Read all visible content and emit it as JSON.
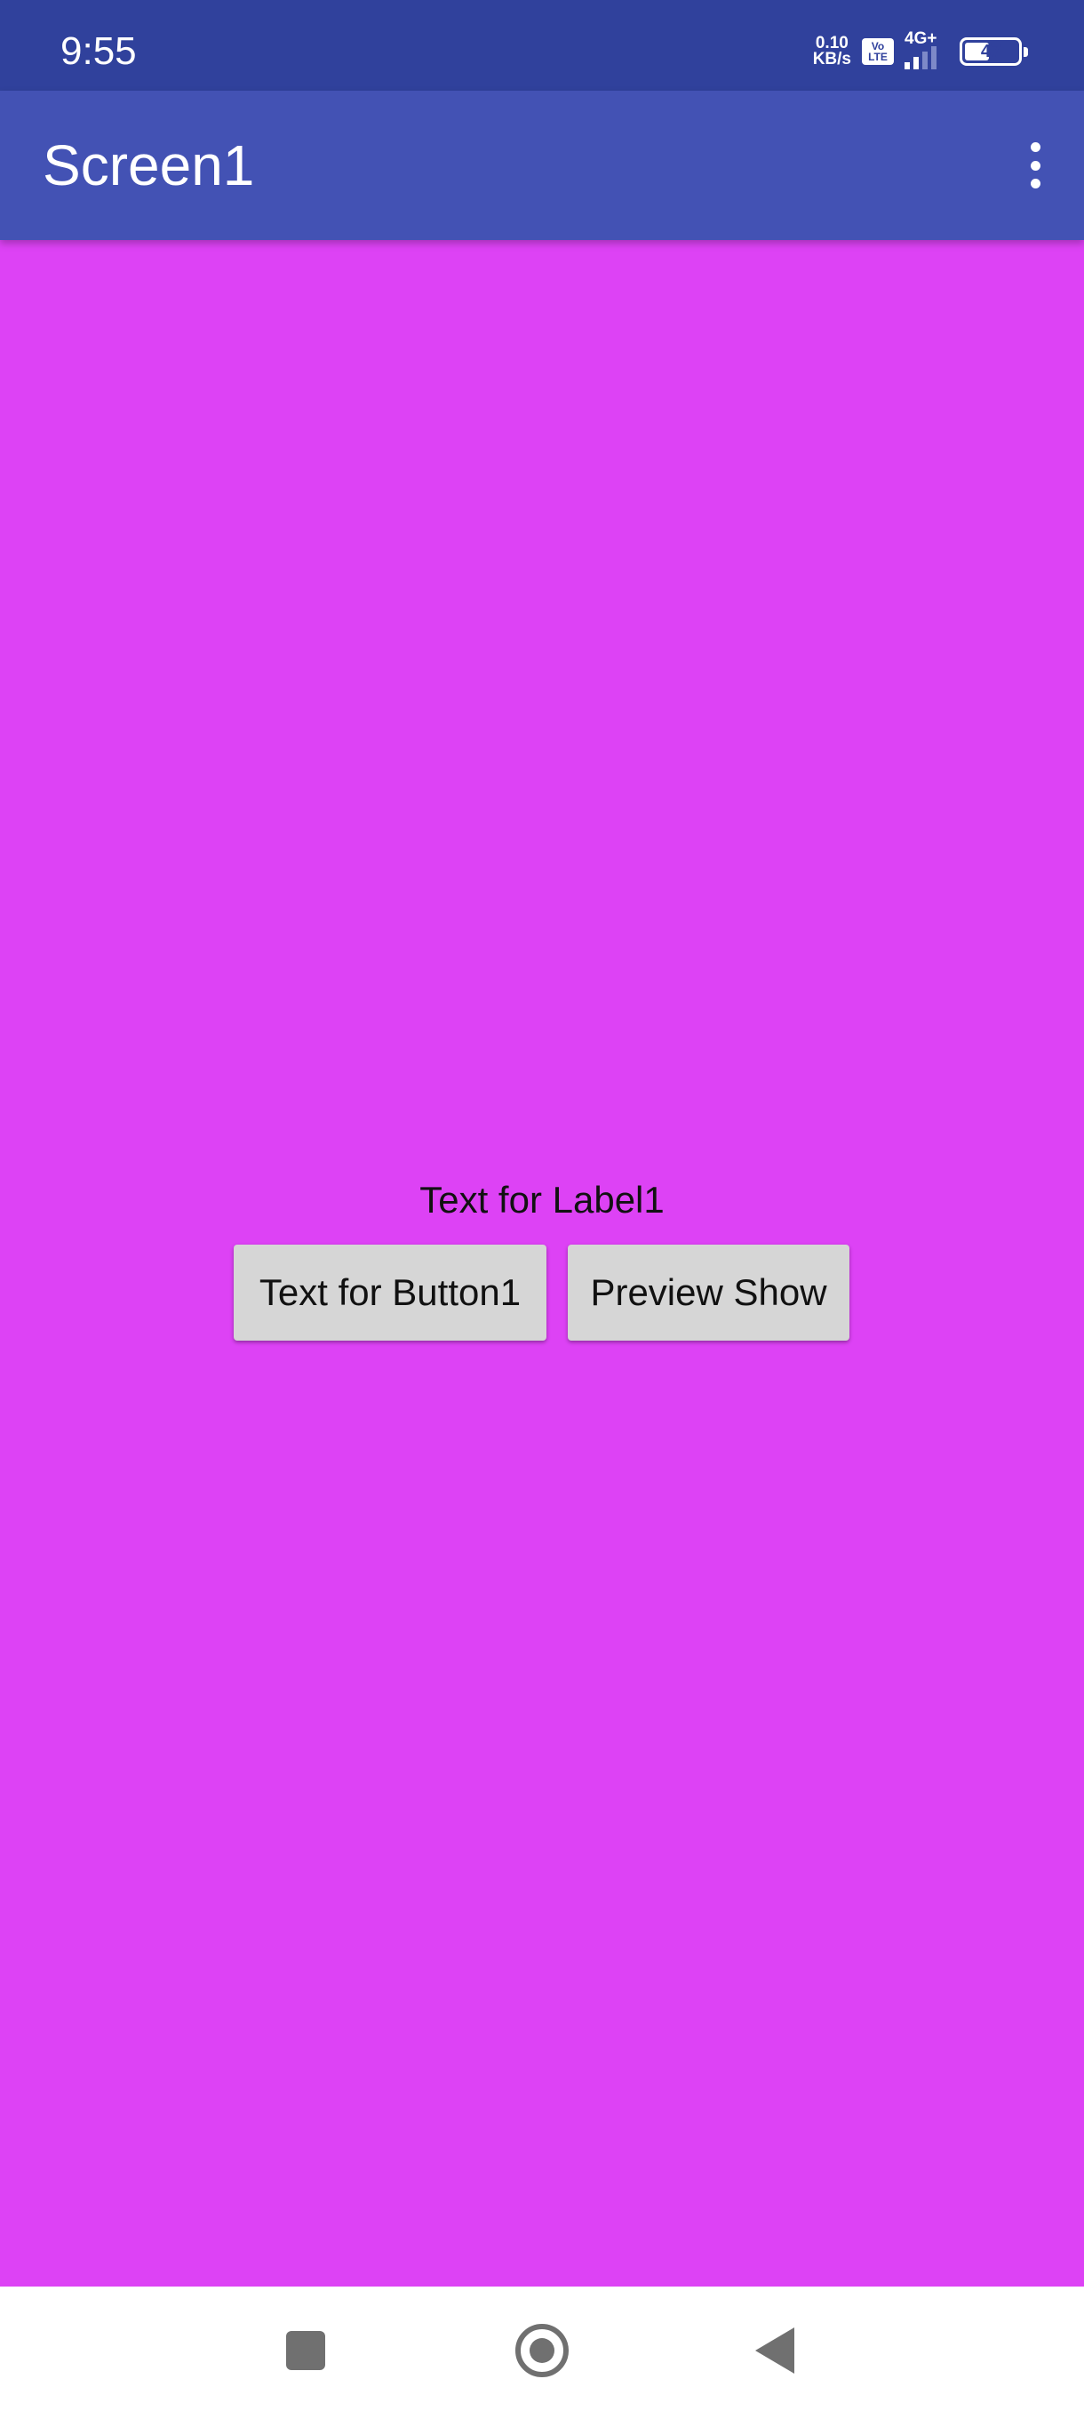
{
  "status_bar": {
    "time": "9:55",
    "net_speed_value": "0.10",
    "net_speed_unit": "KB/s",
    "volte_top": "Vo",
    "volte_bottom": "LTE",
    "network_type": "4G+",
    "battery_level": "47",
    "battery_fraction": 0.47
  },
  "app_bar": {
    "title": "Screen1",
    "menu_icon": "more-vert-icon"
  },
  "content": {
    "background_color": "#dd42f5",
    "label1": "Text for Label1",
    "button1_label": "Text for Button1",
    "button2_label": "Preview Show"
  },
  "nav_bar": {
    "recents_icon": "square-icon",
    "home_icon": "circle-icon",
    "back_icon": "triangle-back-icon"
  },
  "colors": {
    "status_bar": "#30419c",
    "app_bar": "#4352b4",
    "button": "#d6d6d6"
  }
}
